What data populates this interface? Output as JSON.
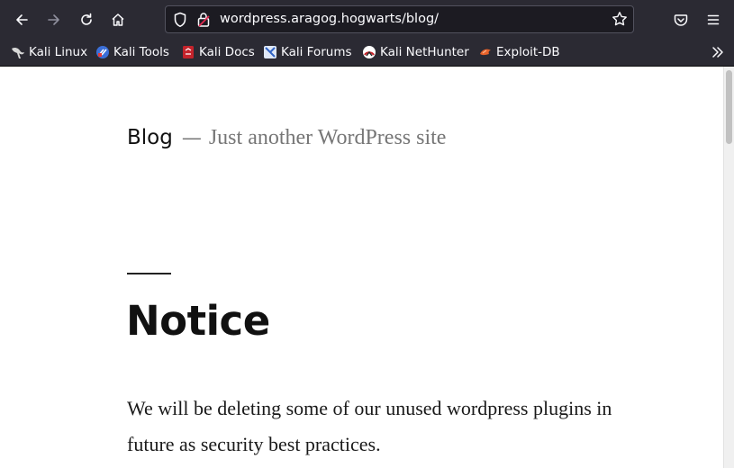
{
  "browser": {
    "url": "wordpress.aragog.hogwarts/blog/",
    "icons": [
      "back-icon",
      "forward-icon",
      "reload-icon",
      "home-icon",
      "shield-icon",
      "lock-icon",
      "star-icon",
      "pocket-icon",
      "menu-icon"
    ]
  },
  "bookmarks": [
    {
      "label": "Kali Linux"
    },
    {
      "label": "Kali Tools"
    },
    {
      "label": "Kali Docs"
    },
    {
      "label": "Kali Forums"
    },
    {
      "label": "Kali NetHunter"
    },
    {
      "label": "Exploit-DB"
    }
  ],
  "site": {
    "name": "Blog",
    "separator": "—",
    "tagline": "Just another WordPress site"
  },
  "post": {
    "title": "Notice",
    "body": "We will be deleting some of our unused wordpress plugins in future as security best practices."
  },
  "colors": {
    "toolbar_bg": "#2b2a33",
    "urlbar_bg": "#1c1b22",
    "page_bg": "#ffffff",
    "tagline": "#767676"
  }
}
